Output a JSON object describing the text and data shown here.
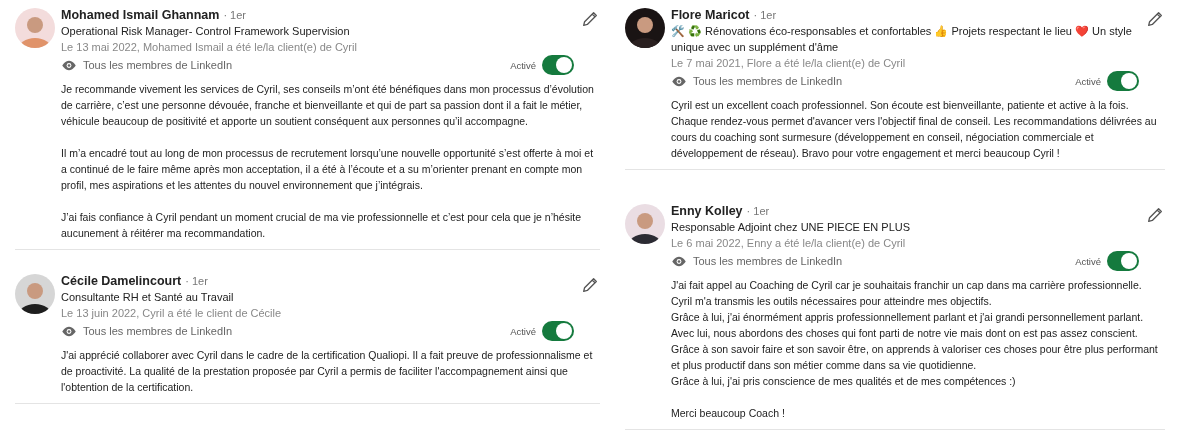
{
  "columns": [
    {
      "recommendations": [
        {
          "name": "Mohamed Ismail Ghannam",
          "degree": "· 1er",
          "headline": "Operational Risk Manager- Control Framework Supervision",
          "date_line": "Le 13 mai 2022, Mohamed Ismail a été le/la client(e) de Cyril",
          "visibility": "Tous les membres de LinkedIn",
          "toggle_label": "Activé",
          "on": true,
          "paragraphs": [
            "Je recommande vivement les services de Cyril, ses conseils m’ont été bénéfiques dans mon processus d’évolution de carrière, c’est une personne dévouée, franche et bienveillante et qui de part sa passion dont il a fait le métier, véhicule beaucoup de positivité et apporte un soutient conséquent aux personnes qu’il accompagne.",
            "Il m’a encadré tout au long de mon processus de recrutement lorsqu’une nouvelle opportunité s’est offerte à moi et a continué de le faire même après mon acceptation, il a été à l’écoute et a su m’orienter prenant en compte mon profil, mes aspirations et les attentes du nouvel environnement que j’intégrais.",
            "J’ai fais confiance à Cyril pendant un moment crucial de ma vie professionnelle et c’est pour cela que je n’hésite aucunement à réitérer ma recommandation."
          ]
        },
        {
          "name": "Cécile Damelincourt",
          "degree": "· 1er",
          "headline": "Consultante RH et Santé au Travail",
          "date_line": "Le 13 juin 2022, Cyril a été le client de Cécile",
          "visibility": "Tous les membres de LinkedIn",
          "toggle_label": "Activé",
          "on": true,
          "paragraphs": [
            "J'ai apprécié collaborer avec Cyril dans le cadre de la certification Qualiopi. Il a fait preuve de professionnalisme et de proactivité. La qualité de la prestation proposée par Cyril a permis de faciliter l'accompagnement ainsi que l'obtention de la certification."
          ]
        }
      ]
    },
    {
      "recommendations": [
        {
          "name": "Flore Maricot",
          "degree": "· 1er",
          "headline": "🛠️ ♻️ Rénovations éco-responsables et confortables 👍 Projets respectant le lieu ❤️ Un style unique avec un supplément d'âme",
          "date_line": "Le 7 mai 2021, Flore a été le/la client(e) de Cyril",
          "visibility": "Tous les membres de LinkedIn",
          "toggle_label": "Activé",
          "on": true,
          "paragraphs": [
            "Cyril est un excellent coach professionnel. Son écoute est bienveillante, patiente et active à la fois.\nChaque rendez-vous permet d'avancer vers l'objectif final de conseil. Les recommandations délivrées au cours du coaching sont surmesure (développement en conseil, négociation commerciale et développement de réseau). Bravo pour votre engagement et merci beaucoup Cyril !"
          ]
        },
        {
          "name": "Enny Kolley",
          "degree": "· 1er",
          "headline": "Responsable Adjoint chez UNE PIECE EN PLUS",
          "date_line": "Le 6 mai 2022, Enny a été le/la client(e) de Cyril",
          "visibility": "Tous les membres de LinkedIn",
          "toggle_label": "Activé",
          "on": true,
          "paragraphs": [
            "J'ai fait appel au Coaching de Cyril car je souhaitais franchir un cap dans ma carrière professionnelle. Cyril m'a transmis les outils nécessaires pour atteindre mes objectifs.\nGrâce à lui, j'ai énormément appris professionnellement parlant et j'ai grandi personnellement parlant.\nAvec lui, nous abordons des choses qui font parti de notre vie mais dont on est pas assez conscient.\nGrâce à son savoir faire et son savoir être, on apprends à valoriser ces choses pour être plus performant et plus productif dans son métier comme dans sa vie quotidienne.\nGrâce à lui, j'ai pris conscience de mes qualités et de mes compétences :)",
            "Merci beaucoup Coach !"
          ]
        }
      ]
    }
  ]
}
